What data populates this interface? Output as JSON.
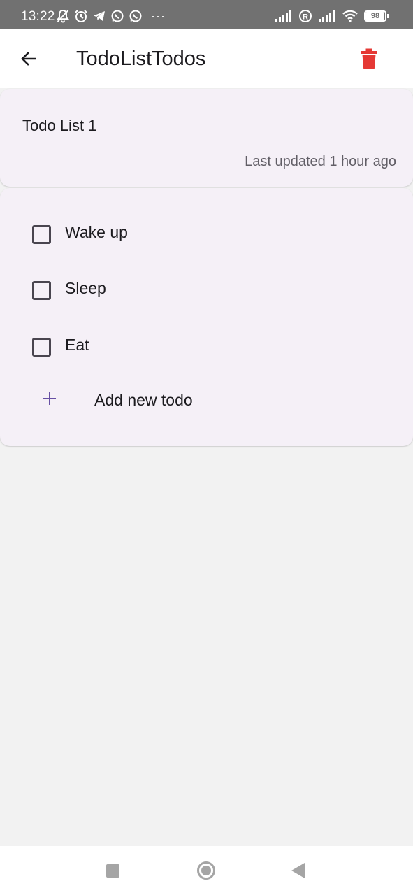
{
  "status_bar": {
    "time": "13:22",
    "battery": "98",
    "battery_level": 0.98,
    "left_icons": [
      "muted-bell-icon",
      "alarm-icon",
      "telegram-icon",
      "whatsapp-icon",
      "whatsapp-icon"
    ],
    "right_icons": [
      "signal-icon",
      "roaming-icon",
      "signal-icon",
      "wifi-icon",
      "battery-icon"
    ],
    "more": "···"
  },
  "app_bar": {
    "title": "TodoListTodos",
    "back_icon": "arrow-back-icon",
    "delete_icon": "trash-icon",
    "delete_color": "#e53935"
  },
  "list_info": {
    "name": "Todo List 1",
    "last_updated": "Last updated 1 hour ago"
  },
  "todos": [
    {
      "label": "Wake up",
      "checked": false
    },
    {
      "label": "Sleep",
      "checked": false
    },
    {
      "label": "Eat",
      "checked": false
    }
  ],
  "add_todo": {
    "label": "Add new todo",
    "icon": "plus-icon",
    "icon_color": "#6750a4"
  },
  "colors": {
    "card_background": "#f5f0f7",
    "page_background": "#f2f2f2",
    "status_bar": "#717171"
  },
  "nav_bar": {
    "buttons": [
      "recents-icon",
      "home-icon",
      "back-triangle-icon"
    ]
  }
}
